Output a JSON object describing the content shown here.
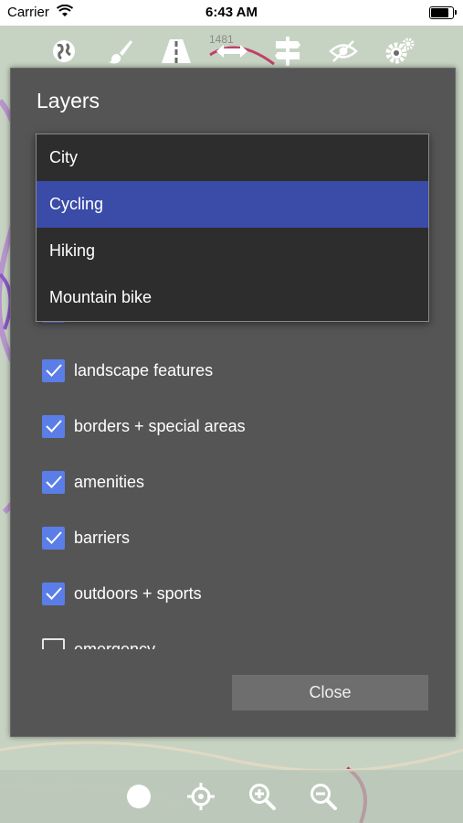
{
  "status_bar": {
    "carrier": "Carrier",
    "time": "6:43 AM",
    "battery_level": 0.9
  },
  "toolbar": {
    "icons": [
      "globe-icon",
      "brush-icon",
      "road-icon",
      "horizontal-arrows-icon",
      "signpost-icon",
      "hidden-eye-icon",
      "gears-icon"
    ],
    "map_label": "1481"
  },
  "layers_dialog": {
    "title": "Layers",
    "dropdown": {
      "options": [
        "City",
        "Cycling",
        "Hiking",
        "Mountain bike"
      ],
      "selected": "Cycling"
    },
    "items": [
      {
        "label": "landscape features",
        "checked": true
      },
      {
        "label": "borders + special areas",
        "checked": true
      },
      {
        "label": "amenities",
        "checked": true
      },
      {
        "label": "barriers",
        "checked": true
      },
      {
        "label": "outdoors + sports",
        "checked": true
      },
      {
        "label": "emergency",
        "checked": false
      }
    ],
    "close_label": "Close"
  },
  "bottom_bar": {
    "icons": [
      "record-icon",
      "locate-icon",
      "zoom-in-icon",
      "zoom-out-icon"
    ]
  },
  "colors": {
    "dialog_bg": "#555555",
    "checkbox": "#5b7de8",
    "selected_row": "#3a4ba8",
    "toolbar_icon": "#ffffff"
  }
}
